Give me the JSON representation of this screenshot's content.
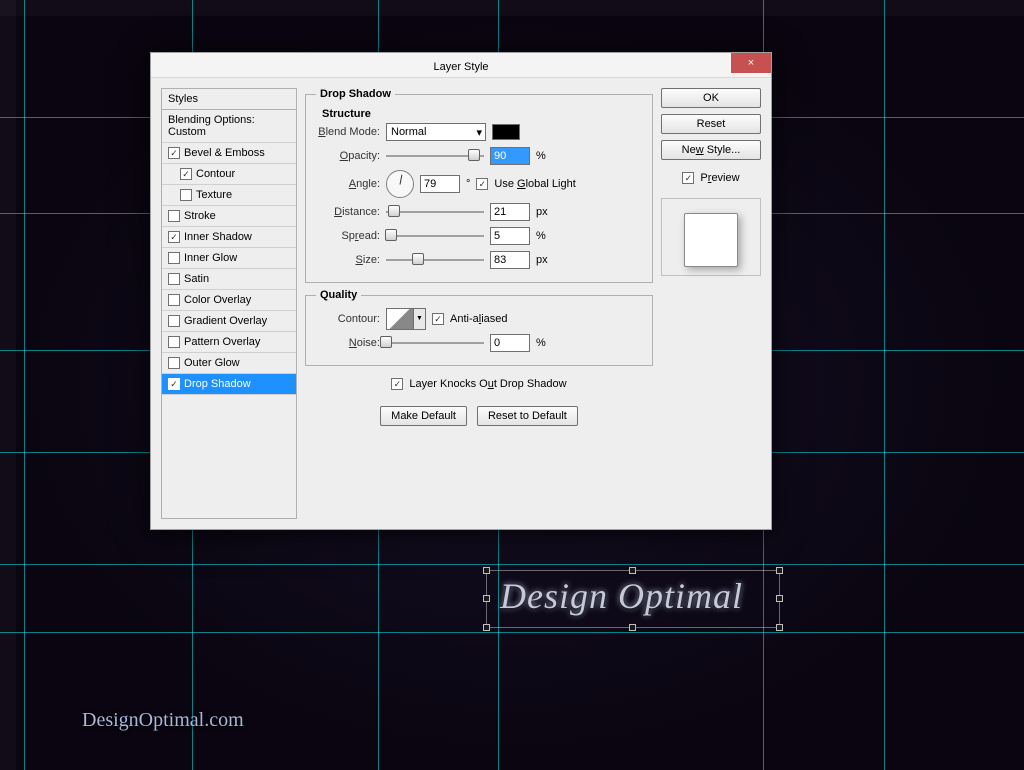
{
  "dialog_title": "Layer Style",
  "styles_panel": {
    "header": "Styles",
    "blending": "Blending Options: Custom",
    "items": [
      {
        "label": "Bevel & Emboss",
        "checked": true,
        "sub": false
      },
      {
        "label": "Contour",
        "checked": true,
        "sub": true
      },
      {
        "label": "Texture",
        "checked": false,
        "sub": true
      },
      {
        "label": "Stroke",
        "checked": false,
        "sub": false
      },
      {
        "label": "Inner Shadow",
        "checked": true,
        "sub": false
      },
      {
        "label": "Inner Glow",
        "checked": false,
        "sub": false
      },
      {
        "label": "Satin",
        "checked": false,
        "sub": false
      },
      {
        "label": "Color Overlay",
        "checked": false,
        "sub": false
      },
      {
        "label": "Gradient Overlay",
        "checked": false,
        "sub": false
      },
      {
        "label": "Pattern Overlay",
        "checked": false,
        "sub": false
      },
      {
        "label": "Outer Glow",
        "checked": false,
        "sub": false
      },
      {
        "label": "Drop Shadow",
        "checked": true,
        "sub": false,
        "selected": true
      }
    ]
  },
  "section_title": "Drop Shadow",
  "structure": {
    "legend": "Structure",
    "blend_mode_label": "Blend Mode:",
    "blend_mode_value": "Normal",
    "opacity_label": "Opacity:",
    "opacity_value": "90",
    "opacity_unit": "%",
    "angle_label": "Angle:",
    "angle_value": "79",
    "angle_unit": "°",
    "global_light_label": "Use Global Light",
    "distance_label": "Distance:",
    "distance_value": "21",
    "distance_unit": "px",
    "spread_label": "Spread:",
    "spread_value": "5",
    "spread_unit": "%",
    "size_label": "Size:",
    "size_value": "83",
    "size_unit": "px"
  },
  "quality": {
    "legend": "Quality",
    "contour_label": "Contour:",
    "anti_aliased_label": "Anti-aliased",
    "noise_label": "Noise:",
    "noise_value": "0",
    "noise_unit": "%"
  },
  "knockout_label": "Layer Knocks Out Drop Shadow",
  "make_default_btn": "Make Default",
  "reset_default_btn": "Reset to Default",
  "buttons": {
    "ok": "OK",
    "reset": "Reset",
    "new_style": "New Style...",
    "preview": "Preview"
  },
  "canvas_text": "Design Optimal",
  "watermark": "DesignOptimal.com"
}
